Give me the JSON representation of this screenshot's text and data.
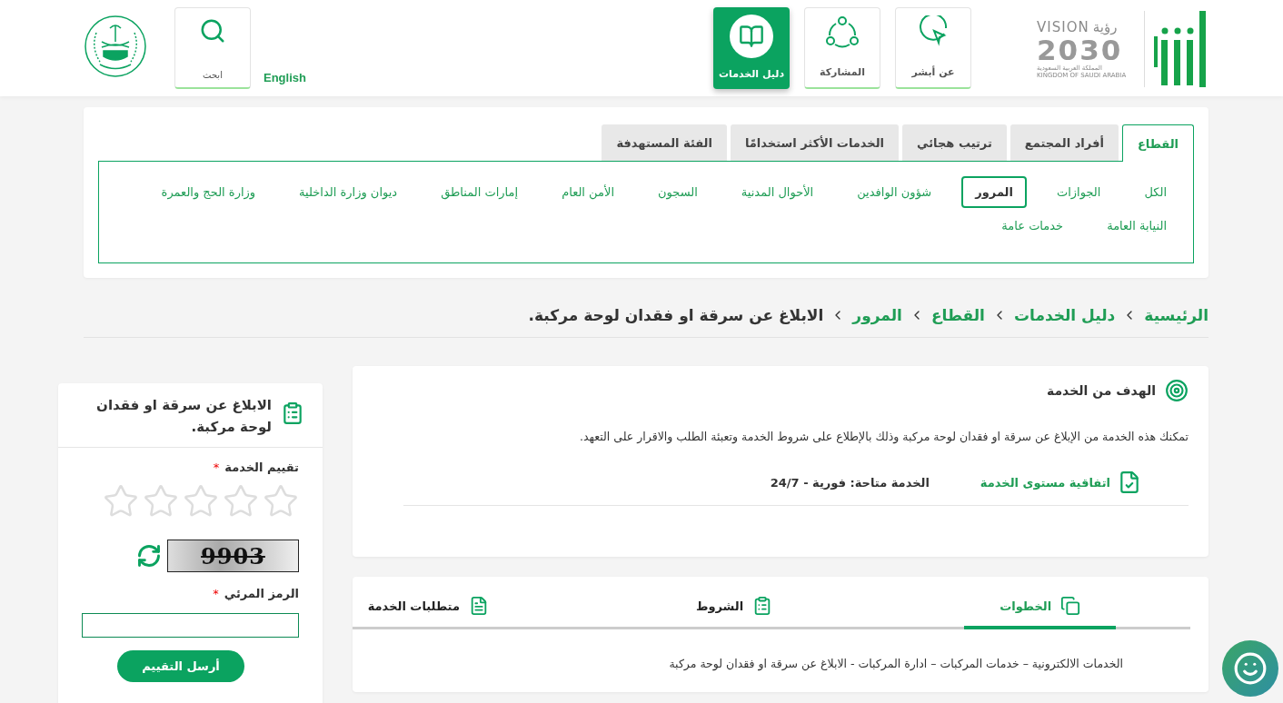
{
  "header": {
    "logo": {
      "brand_ar": "رؤية",
      "brand_en": "VISION",
      "year": "2030",
      "country_ar": "المملكة العربية السعودية",
      "country_en": "KINGDOM OF SAUDI ARABIA"
    },
    "nav": [
      {
        "label": "عن أبشر",
        "kind": "pointer",
        "selected": false
      },
      {
        "label": "المشاركة",
        "kind": "share",
        "selected": false
      },
      {
        "label": "دليل الخدمات",
        "kind": "book",
        "selected": true
      }
    ],
    "language": "English",
    "search": {
      "label": "ابحث"
    }
  },
  "filter_tabs": [
    {
      "label": "القطاع",
      "selected": true
    },
    {
      "label": "أفراد المجتمع",
      "selected": false
    },
    {
      "label": "ترتيب هجائي",
      "selected": false
    },
    {
      "label": "الخدمات الأكثر استخدامًا",
      "selected": false
    },
    {
      "label": "الفئة المستهدفة",
      "selected": false
    }
  ],
  "categories": [
    {
      "label": "الكل",
      "selected": false
    },
    {
      "label": "الجوازات",
      "selected": false
    },
    {
      "label": "المرور",
      "selected": true
    },
    {
      "label": "شؤون الوافدين",
      "selected": false
    },
    {
      "label": "الأحوال المدنية",
      "selected": false
    },
    {
      "label": "السجون",
      "selected": false
    },
    {
      "label": "الأمن العام",
      "selected": false
    },
    {
      "label": "إمارات المناطق",
      "selected": false
    },
    {
      "label": "ديوان وزارة الداخلية",
      "selected": false
    },
    {
      "label": "وزارة الحج والعمرة",
      "selected": false
    },
    {
      "label": "النيابة العامة",
      "selected": false
    },
    {
      "label": "خدمات عامة",
      "selected": false
    }
  ],
  "breadcrumb": [
    "الرئيسية",
    "دليل الخدمات",
    "القطاع",
    "المرور",
    "الابلاغ عن سرقة او فقدان لوحة مركبة."
  ],
  "service_goal": {
    "title": "الهدف من الخدمة",
    "description": "تمكنك هذه الخدمة من الإبلاغ عن سرقة او فقدان لوحة مركبة وذلك بالإطلاع على شروط الخدمة وتعبئة الطلب والاقرار على التعهد.",
    "sla_link": "اتفاقية مستوى الخدمة",
    "availability": "الخدمة متاحة: فورية - 24/7"
  },
  "details_tabs": [
    {
      "label": "الخطوات",
      "kind": "steps",
      "selected": true
    },
    {
      "label": "الشروط",
      "kind": "conditions",
      "selected": false
    },
    {
      "label": "متطلبات الخدمة",
      "kind": "requirements",
      "selected": false
    }
  ],
  "steps_text": "الخدمات الالكترونية – خدمات المركبات – ادارة المركبات - الابلاغ عن سرقة او فقدان لوحة مركبة",
  "rating_panel": {
    "title": "الابلاغ عن سرقة او فقدان لوحة مركبة.",
    "rating_field": {
      "label": "تقييم الخدمة",
      "mark": "*"
    },
    "stars": 0,
    "captcha_text": "9903",
    "captcha_field": {
      "label": "الرمز المرئي",
      "mark": "*"
    },
    "submit": "أرسل التقييم"
  }
}
